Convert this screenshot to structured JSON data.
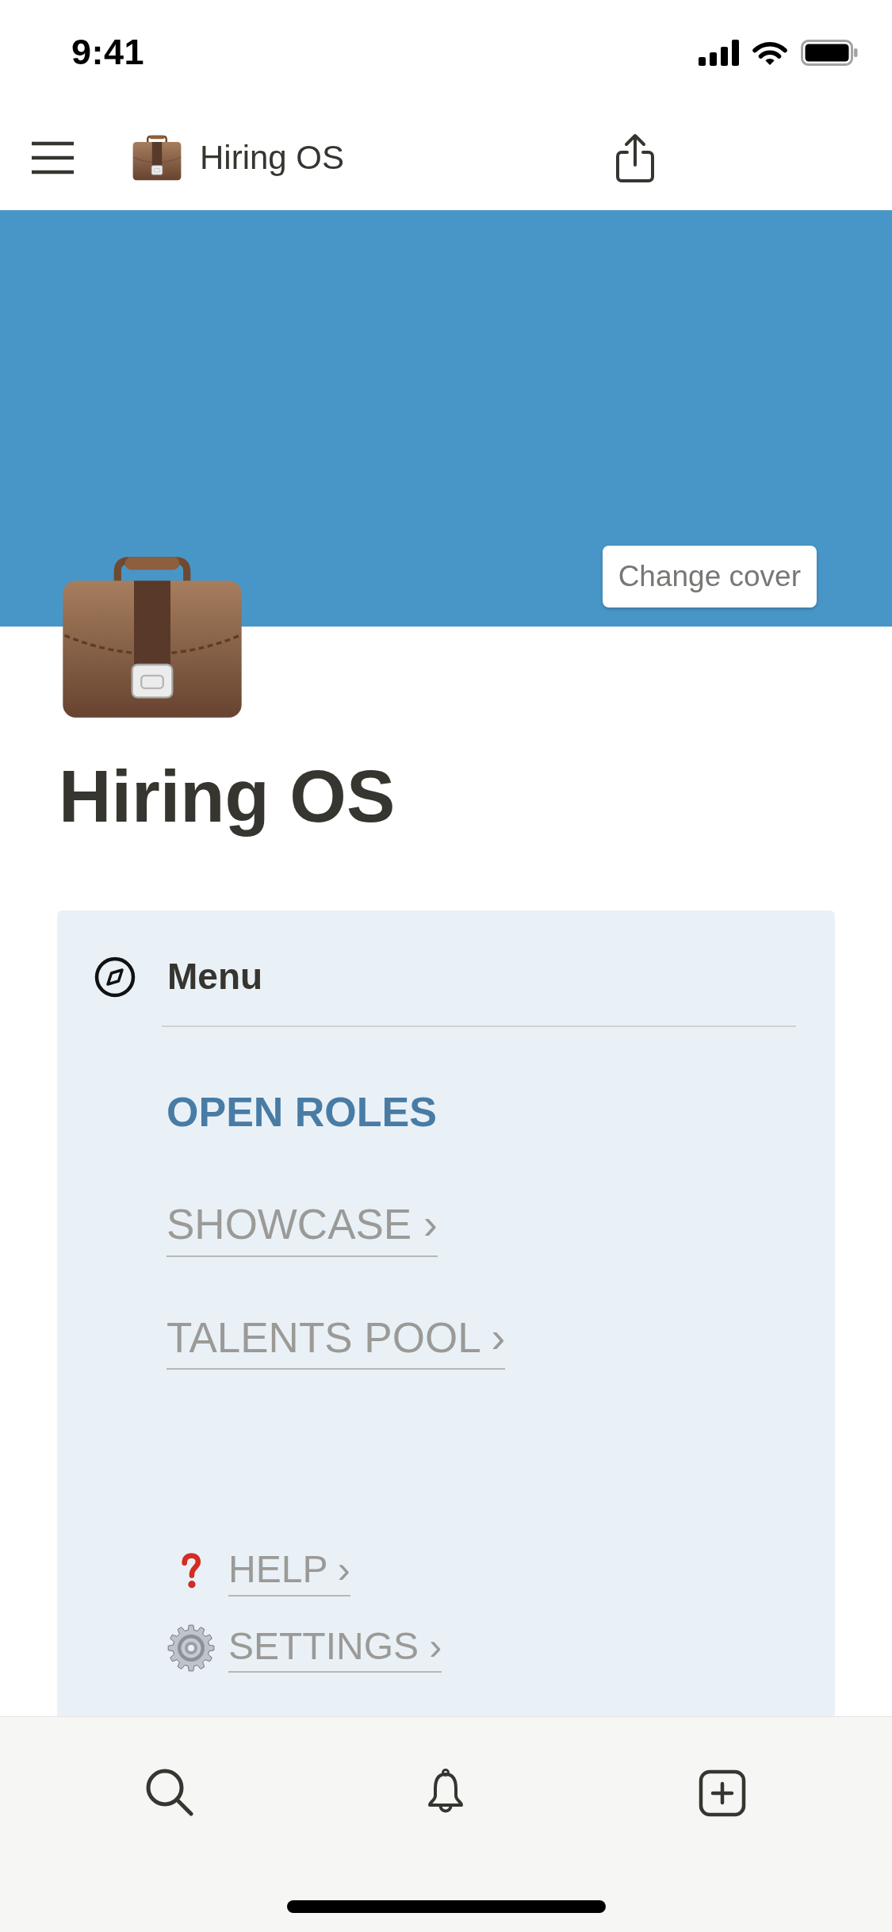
{
  "status_bar": {
    "time": "9:41"
  },
  "nav_bar": {
    "title": "Hiring OS"
  },
  "cover": {
    "button": "Change cover"
  },
  "page": {
    "title": "Hiring OS"
  },
  "menu": {
    "heading": "Menu",
    "items": [
      {
        "label": "OPEN ROLES",
        "selected": true
      },
      {
        "label": "SHOWCASE ›",
        "selected": false
      },
      {
        "label": "TALENTS POOL ›",
        "selected": false
      }
    ],
    "links": [
      {
        "label": "HELP ›"
      },
      {
        "label": "SETTINGS ›"
      }
    ]
  }
}
